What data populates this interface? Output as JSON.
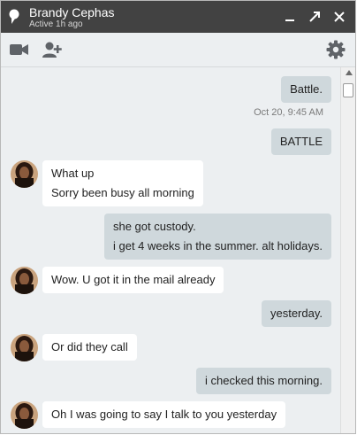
{
  "header": {
    "name": "Brandy Cephas",
    "status": "Active 1h ago"
  },
  "icons": {
    "chat": "chat-bubble-icon",
    "minimize": "minimize-icon",
    "popout": "popout-icon",
    "close": "close-icon",
    "video": "video-call-icon",
    "add_user": "add-person-icon",
    "settings": "gear-icon"
  },
  "colors": {
    "titlebar": "#424242",
    "outgoing_bubble": "#cfd8dc",
    "incoming_bubble": "#ffffff",
    "background": "#eceff1"
  },
  "messages": [
    {
      "direction": "out",
      "lines": [
        "Battle."
      ]
    },
    {
      "timestamp": "Oct 20, 9:45 AM"
    },
    {
      "direction": "out",
      "lines": [
        "BATTLE"
      ]
    },
    {
      "direction": "in",
      "lines": [
        "What up",
        "Sorry been busy all morning"
      ]
    },
    {
      "direction": "out",
      "lines": [
        "she got custody.",
        "i get 4 weeks in the summer. alt holidays."
      ]
    },
    {
      "direction": "in",
      "lines": [
        "Wow. U got it in the mail already"
      ]
    },
    {
      "direction": "out",
      "lines": [
        "yesterday."
      ]
    },
    {
      "direction": "in",
      "lines": [
        "Or did they call"
      ]
    },
    {
      "direction": "out",
      "lines": [
        "i checked this morning."
      ]
    },
    {
      "direction": "in",
      "lines": [
        "Oh I was going to say I talk to you yesterday"
      ]
    }
  ]
}
